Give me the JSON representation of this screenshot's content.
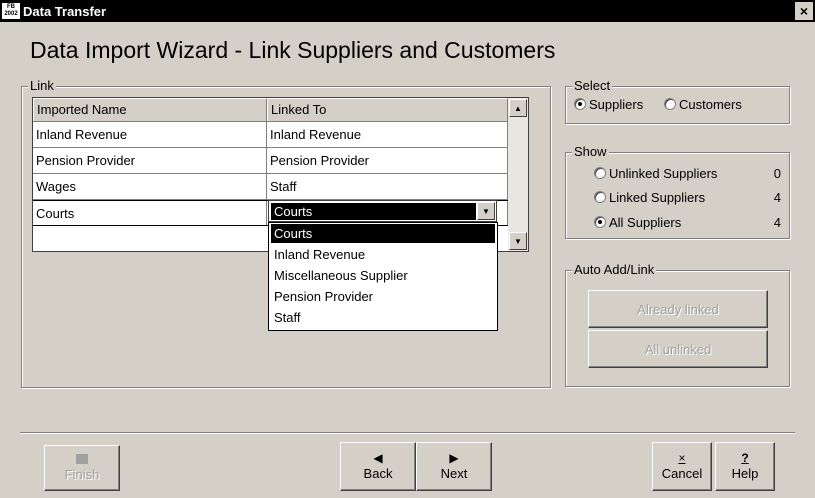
{
  "window": {
    "title": "Data Transfer",
    "app_icon_text": "FB 2002",
    "close_label": "×"
  },
  "page_title": "Data Import Wizard - Link Suppliers and Customers",
  "link_group": {
    "legend": "Link",
    "columns": [
      "Imported Name",
      "Linked To"
    ],
    "rows": [
      {
        "imported": "Inland Revenue",
        "linked": "Inland Revenue"
      },
      {
        "imported": "Pension Provider",
        "linked": "Pension Provider"
      },
      {
        "imported": "Wages",
        "linked": "Staff"
      },
      {
        "imported": "Courts",
        "linked": "Courts"
      }
    ],
    "combo_value": "Courts",
    "dropdown_options": [
      "Courts",
      "Inland Revenue",
      "Miscellaneous Supplier",
      "Pension Provider",
      "Staff"
    ],
    "dropdown_selected": "Courts"
  },
  "select_group": {
    "legend": "Select",
    "options": [
      {
        "label": "Suppliers",
        "checked": true
      },
      {
        "label": "Customers",
        "checked": false
      }
    ]
  },
  "show_group": {
    "legend": "Show",
    "options": [
      {
        "label": "Unlinked Suppliers",
        "count": "0",
        "checked": false
      },
      {
        "label": "Linked Suppliers",
        "count": "4",
        "checked": false
      },
      {
        "label": "All Suppliers",
        "count": "4",
        "checked": true
      }
    ]
  },
  "auto_group": {
    "legend": "Auto Add/Link",
    "already_linked_label": "Already linked",
    "all_unlinked_label": "All unlinked"
  },
  "footer": {
    "finish_label": "Finish",
    "back_label": "Back",
    "next_label": "Next",
    "cancel_label": "Cancel",
    "help_label": "Help",
    "help_icon": "?",
    "cancel_icon": "×"
  }
}
